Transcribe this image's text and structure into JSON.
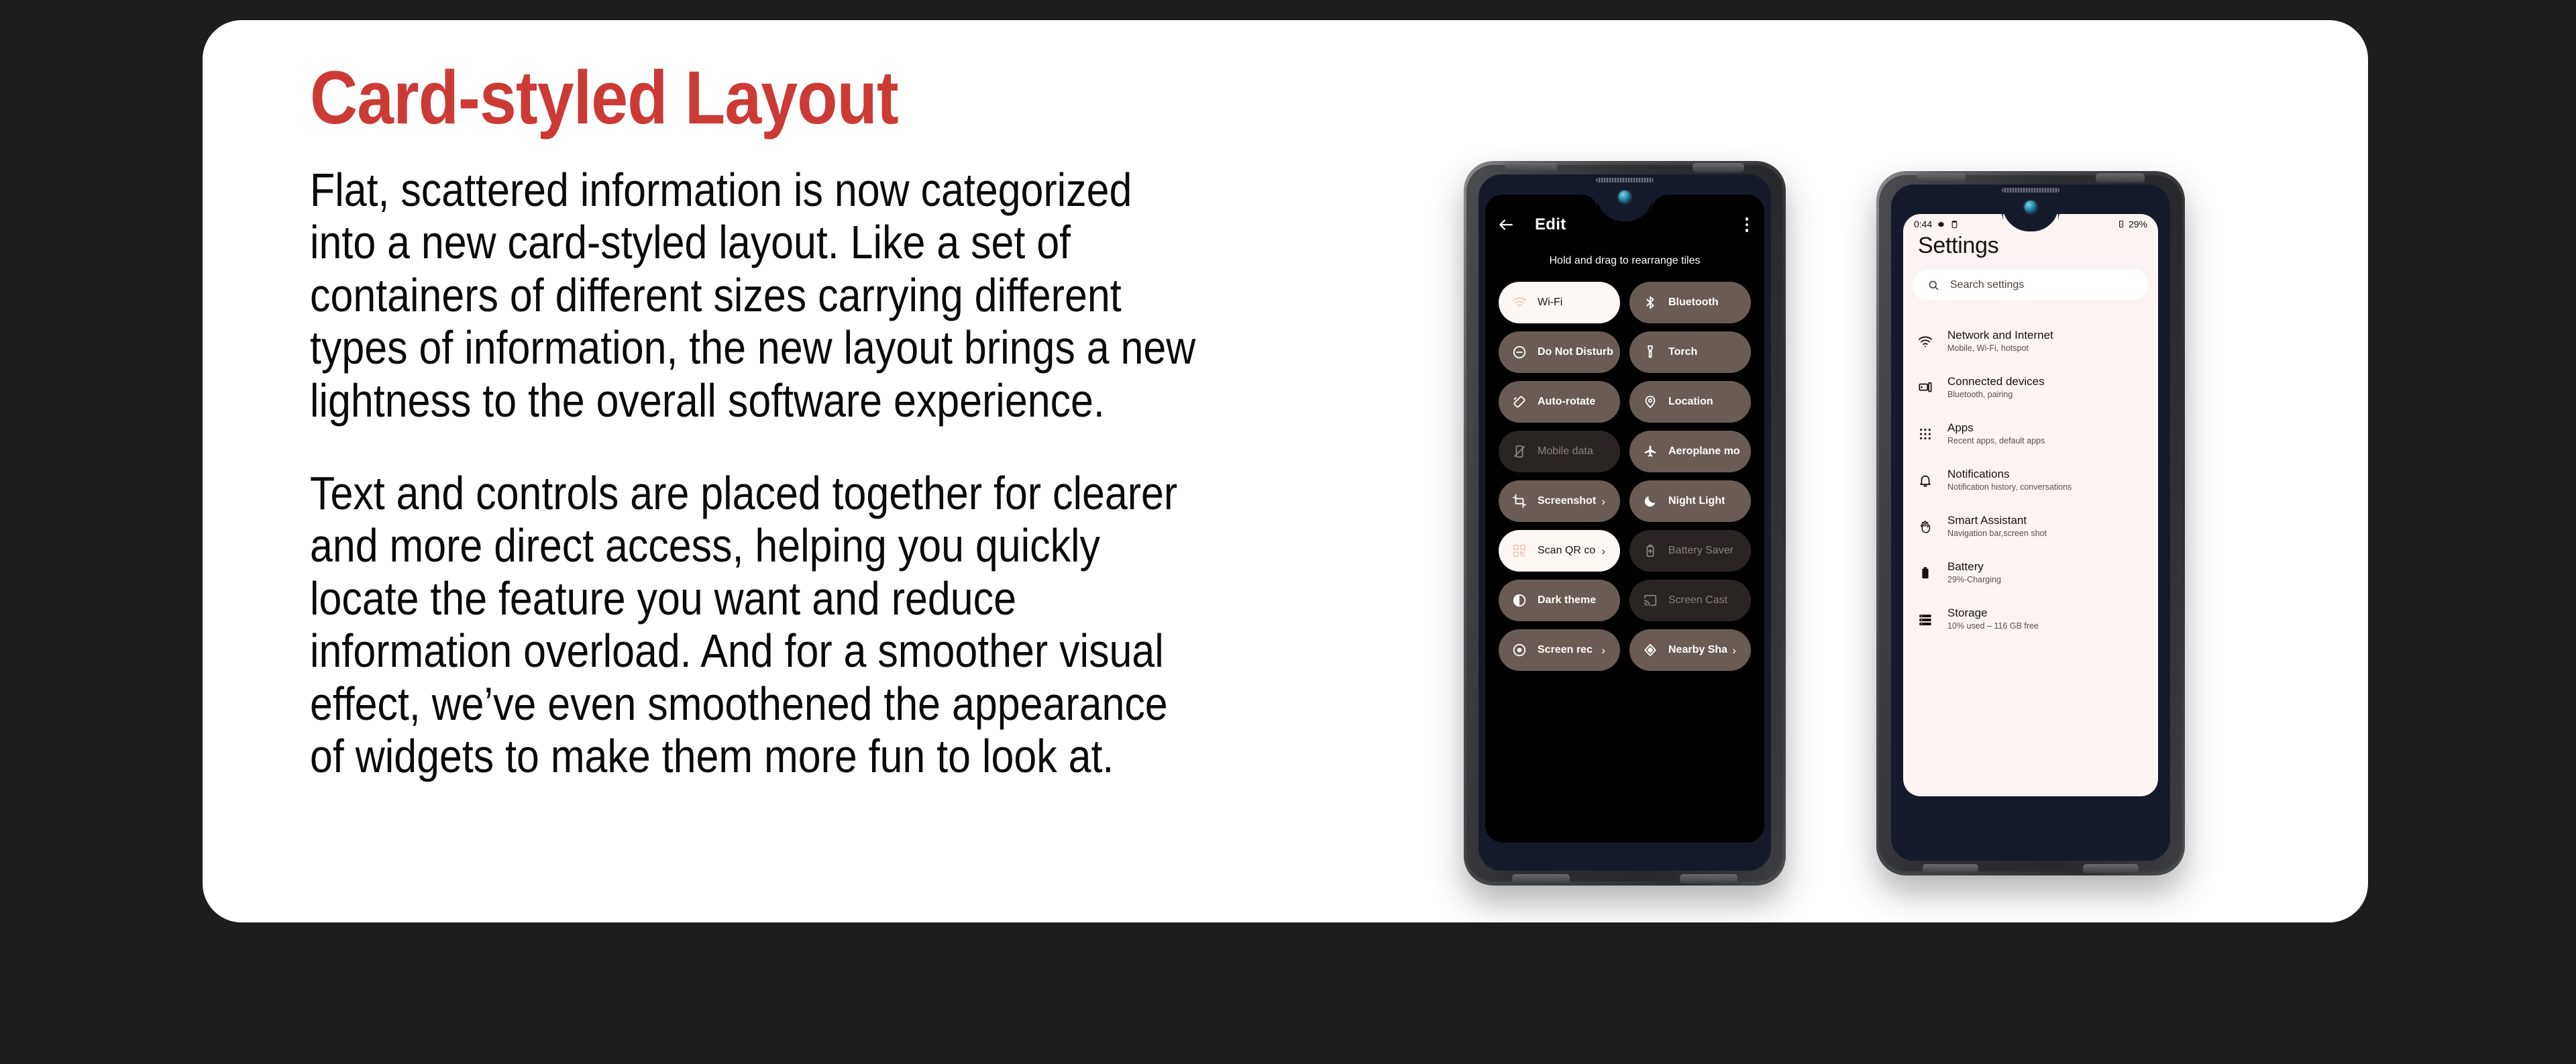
{
  "theme": {
    "background": "#1d1d1d",
    "card_background": "#ffffff",
    "title_color": "#cc3a35",
    "body_color": "#0a0a0a",
    "tile_active": "#fdf8f4",
    "tile_default": "#6a5c55",
    "tile_disabled": "#2a2422",
    "settings_panel": "#fbf4f2",
    "phone_bezel": "#151a2b"
  },
  "slide": {
    "title": "Card-styled Layout",
    "paragraphs": [
      "Flat, scattered information is now categorized into a new card-styled layout. Like a set of containers of different sizes carrying different types of information, the new layout brings a new lightness to the overall software experience.",
      "Text and controls are placed together for clearer and more direct access, helping you quickly locate the feature you want and reduce information overload. And for a smoother visual effect, we’ve even smoothened the appearance of widgets to make them more fun to look at."
    ]
  },
  "phone_left": {
    "screen_name": "quick-settings-edit",
    "header": {
      "back_icon": "arrow-left-icon",
      "title": "Edit",
      "overflow_icon": "kebab-menu-icon"
    },
    "hint": "Hold and drag to rearrange tiles",
    "tiles": [
      {
        "label": "Wi-Fi",
        "icon": "wifi-icon",
        "state": "on",
        "chevron": false
      },
      {
        "label": "Bluetooth",
        "icon": "bluetooth-icon",
        "state": "default",
        "chevron": false
      },
      {
        "label": "Do Not Disturb",
        "icon": "do-not-disturb-icon",
        "state": "default",
        "chevron": false
      },
      {
        "label": "Torch",
        "icon": "flashlight-icon",
        "state": "default",
        "chevron": false
      },
      {
        "label": "Auto-rotate",
        "icon": "auto-rotate-icon",
        "state": "default",
        "chevron": false
      },
      {
        "label": "Location",
        "icon": "location-pin-icon",
        "state": "default",
        "chevron": false
      },
      {
        "label": "Mobile data",
        "icon": "mobile-data-off-icon",
        "state": "disabled",
        "chevron": false
      },
      {
        "label": "Aeroplane mo",
        "icon": "airplane-icon",
        "state": "default",
        "chevron": false
      },
      {
        "label": "Screenshot",
        "icon": "screenshot-icon",
        "state": "default",
        "chevron": true
      },
      {
        "label": "Night Light",
        "icon": "moon-icon",
        "state": "default",
        "chevron": false
      },
      {
        "label": "Scan QR co",
        "icon": "qr-code-icon",
        "state": "on",
        "chevron": true
      },
      {
        "label": "Battery Saver",
        "icon": "battery-saver-icon",
        "state": "disabled",
        "chevron": false
      },
      {
        "label": "Dark theme",
        "icon": "dark-theme-icon",
        "state": "default",
        "chevron": false
      },
      {
        "label": "Screen Cast",
        "icon": "cast-icon",
        "state": "disabled",
        "chevron": false
      },
      {
        "label": "Screen rec",
        "icon": "screen-record-icon",
        "state": "default",
        "chevron": true
      },
      {
        "label": "Nearby Sha",
        "icon": "nearby-share-icon",
        "state": "default",
        "chevron": true
      }
    ]
  },
  "phone_right": {
    "screen_name": "settings-home",
    "status_bar": {
      "time": "0:44",
      "icons": [
        "gear-icon",
        "clipboard-icon"
      ],
      "battery_icon": "battery-charging-icon",
      "battery_percent": "29%"
    },
    "title": "Settings",
    "search": {
      "icon": "search-icon",
      "placeholder": "Search settings"
    },
    "items": [
      {
        "title": "Network and Internet",
        "subtitle": "Mobile, Wi-Fi, hotspot",
        "icon": "wifi-icon"
      },
      {
        "title": "Connected devices",
        "subtitle": "Bluetooth, pairing",
        "icon": "connected-devices-icon"
      },
      {
        "title": "Apps",
        "subtitle": "Recent apps, default apps",
        "icon": "apps-grid-icon"
      },
      {
        "title": "Notifications",
        "subtitle": "Notification history, conversations",
        "icon": "bell-icon"
      },
      {
        "title": "Smart Assistant",
        "subtitle": "Navigation bar,screen shot",
        "icon": "hand-icon"
      },
      {
        "title": "Battery",
        "subtitle": "29%-Charging",
        "icon": "battery-icon"
      },
      {
        "title": "Storage",
        "subtitle": "10% used – 116 GB free",
        "icon": "storage-icon"
      }
    ]
  }
}
